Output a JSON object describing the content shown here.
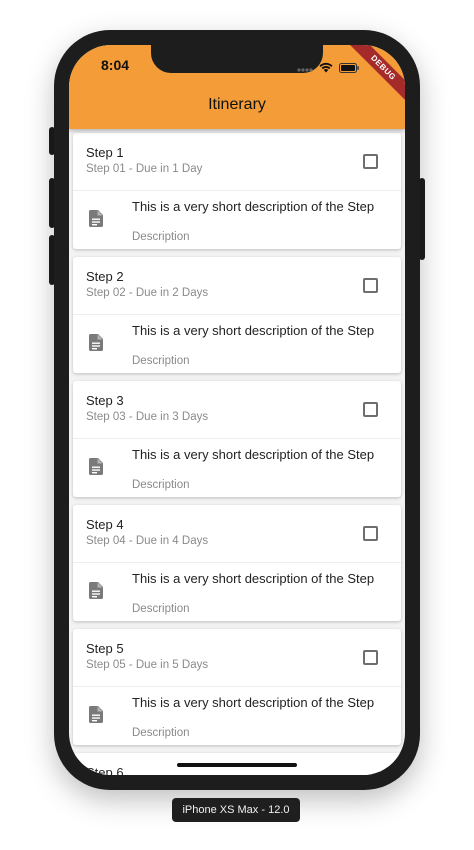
{
  "status_bar": {
    "time": "8:04",
    "debug_banner": "DEBUG"
  },
  "app_bar": {
    "title": "Itinerary",
    "color": "#f39c38"
  },
  "steps": [
    {
      "title": "Step 1",
      "subtitle": "Step 01 - Due in 1 Day",
      "description": "This is a very short description of the Step",
      "description_label": "Description",
      "checked": false
    },
    {
      "title": "Step 2",
      "subtitle": "Step 02 - Due in 2 Days",
      "description": "This is a very short description of the Step",
      "description_label": "Description",
      "checked": false
    },
    {
      "title": "Step 3",
      "subtitle": "Step 03 - Due in 3 Days",
      "description": "This is a very short description of the Step",
      "description_label": "Description",
      "checked": false
    },
    {
      "title": "Step 4",
      "subtitle": "Step 04 - Due in 4 Days",
      "description": "This is a very short description of the Step",
      "description_label": "Description",
      "checked": false
    },
    {
      "title": "Step 5",
      "subtitle": "Step 05 - Due in 5 Days",
      "description": "This is a very short description of the Step",
      "description_label": "Description",
      "checked": false
    },
    {
      "title": "Step 6"
    }
  ],
  "icons": {
    "wifi": "wifi-icon",
    "battery": "battery-icon",
    "signal": "signal-icon",
    "document": "document-icon",
    "checkbox": "checkbox-icon"
  },
  "device_label": "iPhone XS Max - 12.0"
}
